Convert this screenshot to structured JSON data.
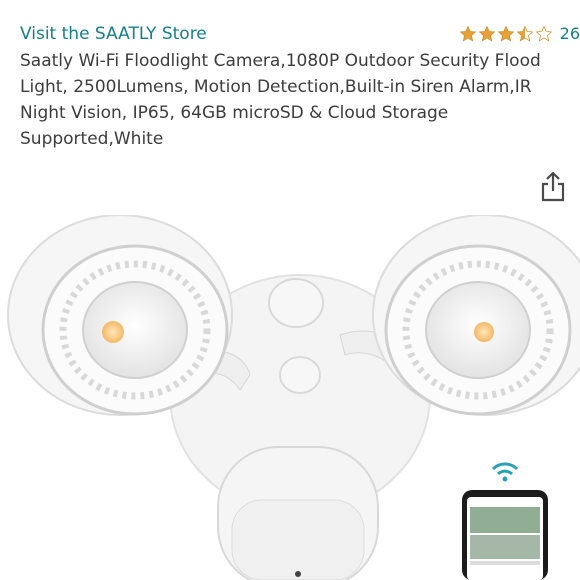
{
  "store": {
    "link_text": "Visit the SAATLY Store"
  },
  "rating": {
    "value": 3.5,
    "max": 5,
    "count": "26",
    "color": "#e7a13b"
  },
  "product": {
    "title": "Saatly Wi-Fi Floodlight Camera,1080P Outdoor Security Flood Light, 2500Lumens, Motion Detection,Built-in Siren Alarm,IR Night Vision, IP65, 64GB microSD & Cloud Storage Supported,White"
  },
  "icons": {
    "share": "share-icon",
    "wifi": "wifi-icon"
  },
  "colors": {
    "link": "#147f8a",
    "text": "#3c3c3c",
    "led": "#f4c37a"
  }
}
